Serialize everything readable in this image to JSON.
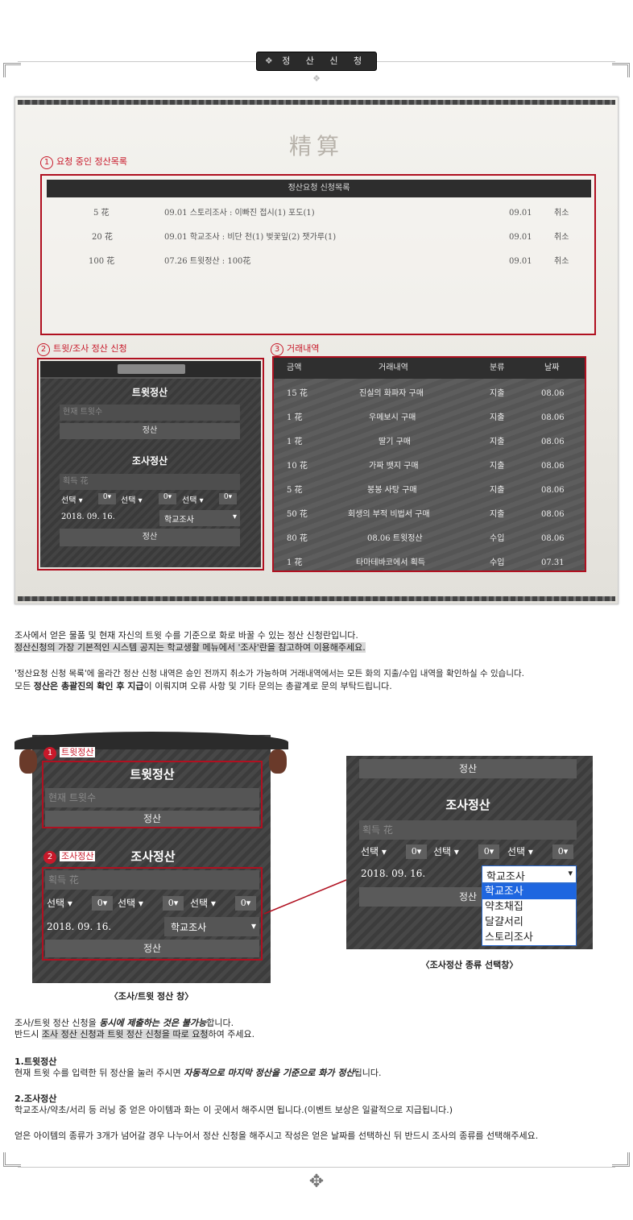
{
  "header": {
    "title": "정 산 신 청",
    "ornament_left": "❖",
    "ornament_right": "❖"
  },
  "panel": {
    "watermark": "精算",
    "section1_num": "1",
    "section1_label": "요청 중인 정산목록",
    "section2_num": "2",
    "section2_label": "트윗/조사 정산 신청",
    "section3_num": "3",
    "section3_label": "거래내역",
    "request_table": {
      "title": "정산요청 신청목록",
      "rows": [
        {
          "amount": "5 花",
          "detail": "09.01 스토리조사 : 이빠진 접시(1) 포도(1)",
          "date": "09.01",
          "action": "취소"
        },
        {
          "amount": "20 花",
          "detail": "09.01 학교조사 : 비단 천(1) 벚꽃잎(2) 잿가루(1)",
          "date": "09.01",
          "action": "취소"
        },
        {
          "amount": "100 花",
          "detail": "07.26 트윗정산 : 100花",
          "date": "09.01",
          "action": "취소"
        }
      ]
    },
    "settle_card": {
      "tweet_title": "트윗정산",
      "tweet_placeholder": "현재 트윗수",
      "tweet_button": "정산",
      "survey_title": "조사정산",
      "survey_placeholder": "획득 花",
      "selects": [
        "선택",
        "선택",
        "선택"
      ],
      "qtys": [
        "0",
        "0",
        "0"
      ],
      "date": "2018. 09. 16.",
      "type": "학교조사",
      "survey_button": "정산"
    },
    "history": {
      "headers": {
        "amount": "금액",
        "detail": "거래내역",
        "kind": "분류",
        "date": "날짜"
      },
      "rows": [
        {
          "amount": "15 花",
          "detail": "진실의 화파자 구매",
          "kind": "지출",
          "date": "08.06"
        },
        {
          "amount": "1 花",
          "detail": "우메보시 구매",
          "kind": "지출",
          "date": "08.06"
        },
        {
          "amount": "1 花",
          "detail": "딸기 구매",
          "kind": "지출",
          "date": "08.06"
        },
        {
          "amount": "10 花",
          "detail": "가짜 뱃지 구매",
          "kind": "지출",
          "date": "08.06"
        },
        {
          "amount": "5 花",
          "detail": "봉봉 사탕 구매",
          "kind": "지출",
          "date": "08.06"
        },
        {
          "amount": "50 花",
          "detail": "회생의 부적 비법서 구매",
          "kind": "지출",
          "date": "08.06"
        },
        {
          "amount": "80 花",
          "detail": "08.06 트윗정산",
          "kind": "수입",
          "date": "08.06"
        },
        {
          "amount": "1 花",
          "detail": "타마테바코에서 획득",
          "kind": "수입",
          "date": "07.31"
        }
      ]
    }
  },
  "desc": {
    "l1": "조사에서 얻은 물품 및 현재 자신의 트윗 수를 기준으로 화로 바꿀 수 있는 정산 신청란입니다.",
    "l2": "정산신청의 가장 기본적인 시스템 공지는 학교생활 메뉴에서 '조사'란을 참고하여 이용해주세요.",
    "l3": "'정산요청 신청 목록'에 올라간 정산 신청 내역은 승인 전까지 취소가 가능하며 거래내역에서는 모든 화의 지출/수입 내역을 확인하실 수 있습니다.",
    "l4a": "모든 ",
    "l4b": "정산은 총괄진의 확인 후 지급",
    "l4c": "이 이뤄지며 오류 사항 및 기타 문의는 총괄계로 문의 부탁드립니다."
  },
  "zoom_left": {
    "badge1_num": "1",
    "badge1_label": "트윗정산",
    "badge2_num": "2",
    "badge2_label": "조사정산",
    "tweet_title": "트윗정산",
    "tweet_placeholder": "현재 트윗수",
    "tweet_button": "정산",
    "survey_title": "조사정산",
    "survey_placeholder": "획득 花",
    "selects": [
      "선택",
      "선택",
      "선택"
    ],
    "qtys": [
      "0",
      "0",
      "0"
    ],
    "date": "2018. 09. 16.",
    "type": "학교조사",
    "survey_button": "정산",
    "caption": "〈조사/트윗 정산 창〉"
  },
  "zoom_right": {
    "top_button": "정산",
    "survey_title": "조사정산",
    "survey_placeholder": "획득 花",
    "selects": [
      "선택",
      "선택",
      "선택"
    ],
    "qtys": [
      "0",
      "0",
      "0"
    ],
    "date": "2018. 09. 16.",
    "type": "학교조사",
    "survey_button": "정산",
    "options": [
      "학교조사",
      "약초채집",
      "달걀서리",
      "스토리조사"
    ],
    "caption": "〈조사정산 종류 선택창〉"
  },
  "notes": {
    "n1a": "조사/트윗 정산 신청을 ",
    "n1b": "동시에 제출하는 것은 불가능",
    "n1c": "합니다.",
    "n2a": "반드시 ",
    "n2b": "조사 정산 신청과 트윗 정산 신청을 따로 요청",
    "n2c": "하여 주세요.",
    "h1": "1.트윗정산",
    "p1a": "현재 트윗 수를 입력한 뒤 정산을 눌러 주시면 ",
    "p1b": "자동적으로 마지막 정산을 기준으로 화가 정산",
    "p1c": "됩니다.",
    "h2": "2.조사정산",
    "p2": "학교조사/약초/서리 등 러닝 중 얻은 아이템과 화는 이 곳에서 해주시면 됩니다.(이벤트 보상은 일괄적으로 지급됩니다.)",
    "p3": "얻은 아이템의 종류가 3개가 넘어갈 경우 나누어서 정산 신청을 해주시고 작성은 얻은 날짜를 선택하신 뒤 반드시 조사의 종류를 선택해주세요."
  },
  "footer": {
    "ornament": "✥"
  }
}
